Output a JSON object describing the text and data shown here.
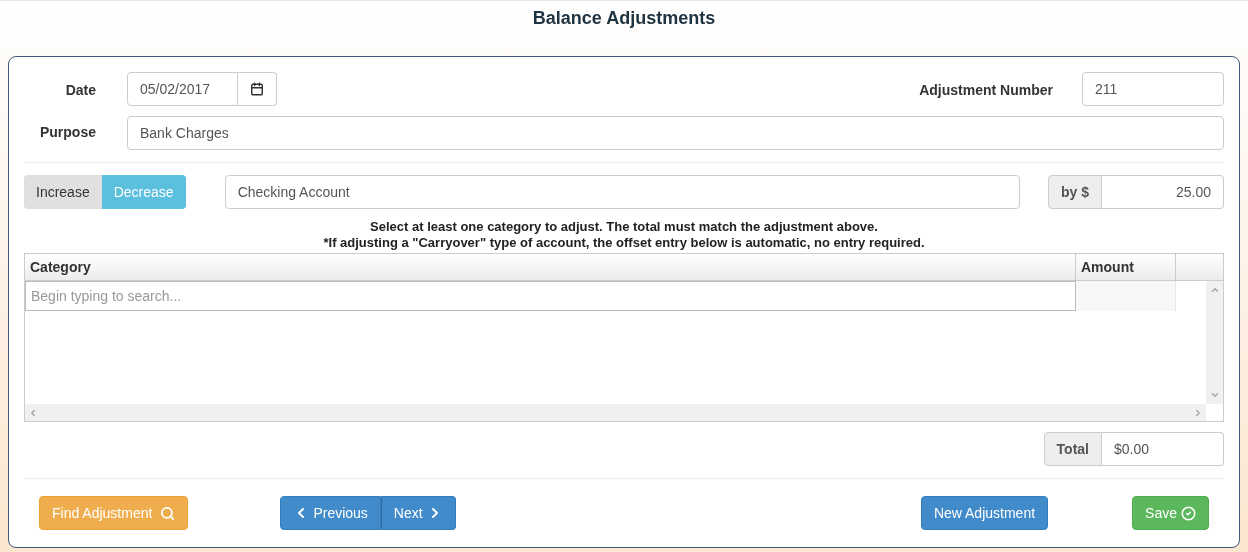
{
  "title": "Balance Adjustments",
  "date": {
    "label": "Date",
    "value": "05/02/2017"
  },
  "adjustment_number": {
    "label": "Adjustment Number",
    "value": "211"
  },
  "purpose": {
    "label": "Purpose",
    "value": "Bank Charges"
  },
  "direction": [
    {
      "label": "Increase",
      "selected": false
    },
    {
      "label": "Decrease",
      "selected": true
    }
  ],
  "account": {
    "value": "Checking Account"
  },
  "amount": {
    "prefix": "by $",
    "value": "25.00"
  },
  "instructions": [
    "Select at least one category to adjust. The total must match the adjustment above.",
    "*If adjusting a \"Carryover\" type of account, the offset entry below is automatic, no entry required."
  ],
  "grid": {
    "columns": [
      "Category",
      "Amount"
    ],
    "search": {
      "placeholder": "Begin typing to search..."
    }
  },
  "total": {
    "label": "Total",
    "value": "$0.00"
  },
  "buttons": [
    {
      "kind": "find",
      "label": "Find Adjustment"
    },
    {
      "kind": "previous",
      "label": "Previous"
    },
    {
      "kind": "next",
      "label": "Next"
    },
    {
      "kind": "new",
      "label": "New Adjustment"
    },
    {
      "kind": "save",
      "label": "Save"
    }
  ]
}
